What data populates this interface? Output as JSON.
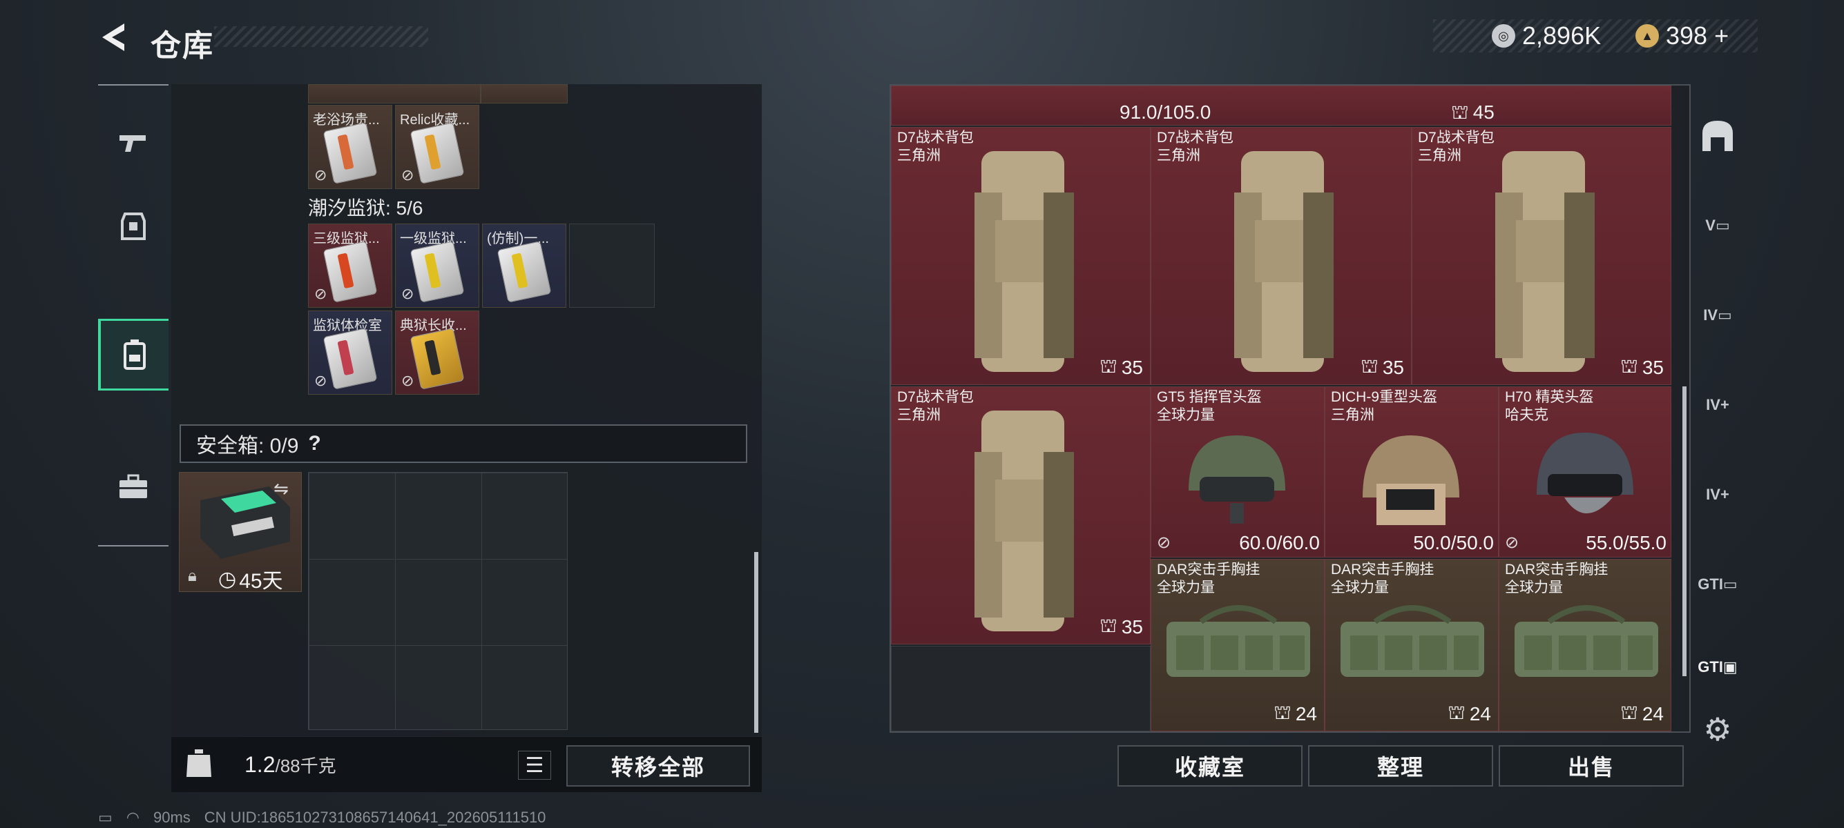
{
  "header": {
    "back_icon": "back-chevron-icon",
    "title": "仓库",
    "currency1": {
      "icon": "silver-coin-icon",
      "value": "2,896K"
    },
    "currency2": {
      "icon": "gold-coin-icon",
      "value": "398",
      "plus": "+"
    }
  },
  "sidebar": {
    "items": [
      {
        "icon": "gun-icon"
      },
      {
        "icon": "armor-icon"
      },
      {
        "icon": "backpack-icon",
        "active": true
      },
      {
        "icon": "case-icon"
      }
    ]
  },
  "left": {
    "top_row": [
      {
        "label": "老浴场贵...",
        "color": "gold",
        "stripe": "#d86a3a"
      },
      {
        "label": "Relic收藏...",
        "color": "gold",
        "stripe": "#e0a030"
      }
    ],
    "prison_label": "潮汐监狱: 5/6",
    "prison_row1": [
      {
        "label": "三级监狱...",
        "color": "red",
        "stripe": "#d84820"
      },
      {
        "label": "一级监狱...",
        "color": "blue",
        "stripe": "#e0c020"
      },
      {
        "label": "(仿制)一...",
        "color": "blue",
        "stripe": "#e0c020"
      }
    ],
    "prison_row2": [
      {
        "label": "监狱体检室",
        "color": "blue",
        "stripe": "#c04050"
      },
      {
        "label": "典狱长收...",
        "color": "red",
        "stripe": "#e8b030"
      }
    ],
    "safebox_label": "安全箱: 0/9",
    "safebox_help": "?",
    "safe_item_days": "45天",
    "weight_value": "1.2",
    "weight_max": "/88千克",
    "transfer_all": "转移全部"
  },
  "right": {
    "top_partial": {
      "durability": "91.0/105.0",
      "count": "45"
    },
    "items": [
      {
        "name": "D7战术背包",
        "brand": "三角洲",
        "count": "35",
        "type": "backpack"
      },
      {
        "name": "D7战术背包",
        "brand": "三角洲",
        "count": "35",
        "type": "backpack"
      },
      {
        "name": "D7战术背包",
        "brand": "三角洲",
        "count": "35",
        "type": "backpack"
      },
      {
        "name": "D7战术背包",
        "brand": "三角洲",
        "count": "35",
        "type": "backpack"
      },
      {
        "name": "GT5 指挥官头盔",
        "brand": "全球力量",
        "durability": "60.0/60.0",
        "type": "helmet"
      },
      {
        "name": "DICH-9重型头盔",
        "brand": "三角洲",
        "durability": "50.0/50.0",
        "type": "helmet"
      },
      {
        "name": "H70 精英头盔",
        "brand": "哈夫克",
        "durability": "55.0/55.0",
        "type": "helmet"
      },
      {
        "name": "DAR突击手胸挂",
        "brand": "全球力量",
        "count": "24",
        "type": "rig"
      },
      {
        "name": "DAR突击手胸挂",
        "brand": "全球力量",
        "count": "24",
        "type": "rig"
      },
      {
        "name": "DAR突击手胸挂",
        "brand": "全球力量",
        "count": "24",
        "type": "rig"
      }
    ],
    "buttons": {
      "collection": "收藏室",
      "sort": "整理",
      "sell": "出售"
    }
  },
  "right_toolbar": {
    "items": [
      "shelter-icon",
      "V",
      "IV",
      "IV",
      "IV",
      "GTI",
      "GTI"
    ],
    "settings_icon": "gear-icon"
  },
  "status": {
    "ping": "90ms",
    "uid": "CN UID:186510273108657140641_202605111510"
  }
}
